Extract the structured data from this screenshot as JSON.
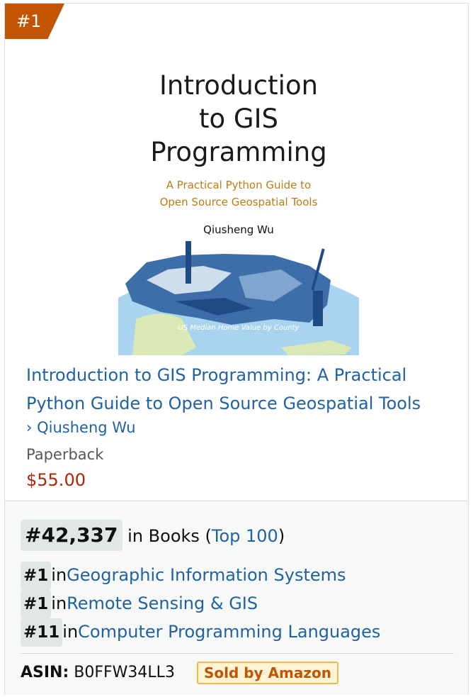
{
  "badge": {
    "rank_label": "#1"
  },
  "cover": {
    "title": "Introduction\nto GIS\nProgramming",
    "subtitle": "A Practical Python Guide to\nOpen Source Geospatial Tools",
    "author": "Qiusheng Wu",
    "map_caption": "US Median Home Value by County"
  },
  "product": {
    "title": "Introduction to GIS Programming: A Practical Python Guide to Open Source Geospatial Tools",
    "author_prefix": "›",
    "author": "Qiusheng Wu",
    "format": "Paperback",
    "price": "$55.00"
  },
  "rankings": {
    "main": {
      "rank": "#42,337",
      "in_text": "in Books (",
      "top_link": "Top 100",
      "close": ")"
    },
    "sub": [
      {
        "rank": "#1",
        "in": "in",
        "category": "Geographic Information Systems"
      },
      {
        "rank": "#1",
        "in": "in",
        "category": "Remote Sensing & GIS"
      },
      {
        "rank": "#11",
        "in": "in",
        "category": "Computer Programming Languages"
      }
    ]
  },
  "asin": {
    "label": "ASIN:",
    "value": "B0FFW34LL3",
    "sold_badge": "Sold by Amazon"
  },
  "colors": {
    "accent": "#c45500",
    "link": "#2162a1",
    "price": "#b12704"
  }
}
